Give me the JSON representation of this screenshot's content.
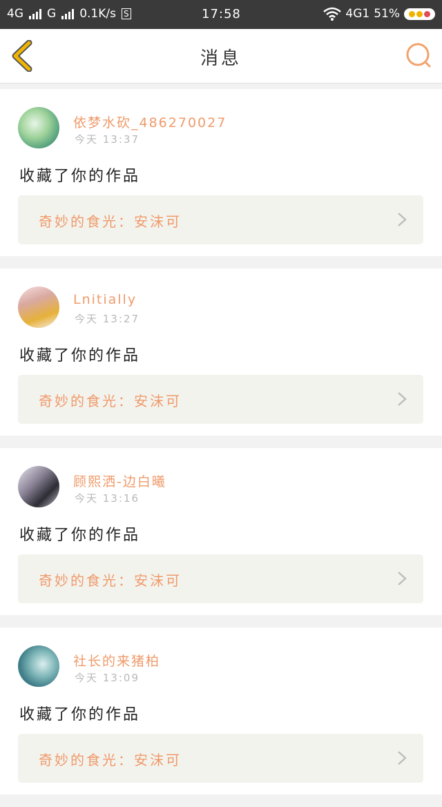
{
  "status_bar": {
    "network_1": "4G",
    "network_2": "G",
    "speed": "0.1K/s",
    "sim_label": "S",
    "time": "17:58",
    "network_3": "4G1",
    "battery": "51%"
  },
  "nav": {
    "title": "消息"
  },
  "messages": [
    {
      "username": "依梦水砍_486270027",
      "time": "今天 13:37",
      "action": "收藏了你的作品",
      "work_title": "奇妙的食光：安沫可"
    },
    {
      "username": "Lnitially",
      "time": "今天 13:27",
      "action": "收藏了你的作品",
      "work_title": "奇妙的食光：安沫可"
    },
    {
      "username": "顾熙洒-边白曦",
      "time": "今天 13:16",
      "action": "收藏了你的作品",
      "work_title": "奇妙的食光：安沫可"
    },
    {
      "username": "社长的来猪柏",
      "time": "今天 13:09",
      "action": "收藏了你的作品",
      "work_title": "奇妙的食光：安沫可"
    }
  ],
  "icons": {
    "back": "chevron-left-icon",
    "search": "search-icon",
    "item_arrow": "chevron-right-icon"
  },
  "colors": {
    "accent": "#ef9a6a",
    "back_icon": "#f0b400",
    "search_icon": "#f2a26b",
    "status_bar_bg": "#3a3a3a"
  }
}
